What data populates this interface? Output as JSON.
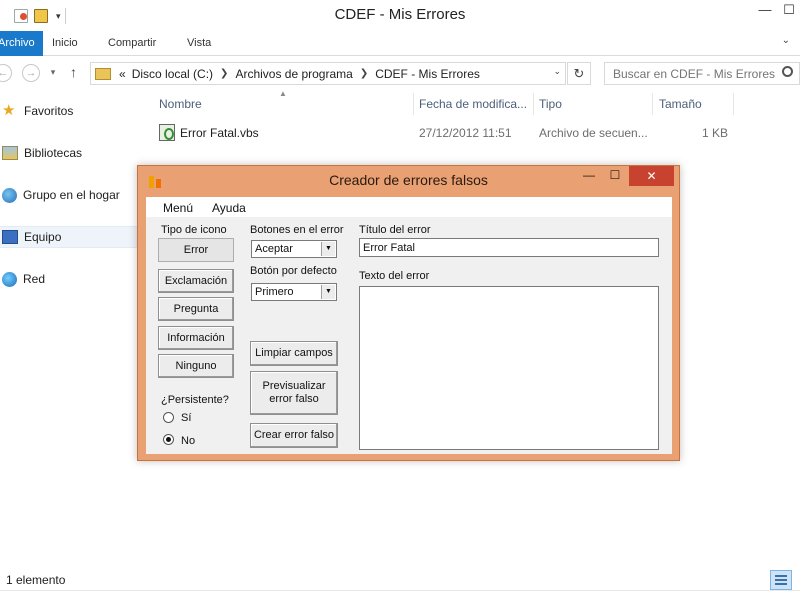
{
  "window": {
    "title": "CDEF - Mis Errores"
  },
  "ribbon": {
    "tabs": [
      "Archivo",
      "Inicio",
      "Compartir",
      "Vista"
    ]
  },
  "address": {
    "prefix": "«",
    "crumbs": [
      "Disco local (C:)",
      "Archivos de programa",
      "CDEF - Mis Errores"
    ],
    "search_placeholder": "Buscar en CDEF - Mis Errores"
  },
  "nav": {
    "items": [
      {
        "label": "Favoritos",
        "icon": "star-icon"
      },
      {
        "label": "Bibliotecas",
        "icon": "libraries-icon"
      },
      {
        "label": "Grupo en el hogar",
        "icon": "homegroup-icon"
      },
      {
        "label": "Equipo",
        "icon": "computer-icon",
        "selected": true
      },
      {
        "label": "Red",
        "icon": "network-icon"
      }
    ]
  },
  "filelist": {
    "columns": [
      "Nombre",
      "Fecha de modifica...",
      "Tipo",
      "Tamaño"
    ],
    "rows": [
      {
        "name": "Error Fatal.vbs",
        "date": "27/12/2012 11:51",
        "type": "Archivo de secuen...",
        "size": "1 KB"
      }
    ]
  },
  "status": {
    "text": "1 elemento"
  },
  "dialog": {
    "title": "Creador de errores falsos",
    "menu": [
      "Menú",
      "Ayuda"
    ],
    "icon_type": {
      "label": "Tipo de icono",
      "buttons": [
        "Error",
        "Exclamación",
        "Pregunta",
        "Información",
        "Ninguno"
      ]
    },
    "buttons_in_error": {
      "label": "Botones en el error",
      "value": "Aceptar"
    },
    "default_button": {
      "label": "Botón por defecto",
      "value": "Primero"
    },
    "persistent": {
      "label": "¿Persistente?",
      "yes": "Sí",
      "no": "No",
      "selected": "No"
    },
    "actions": {
      "clear": "Limpiar campos",
      "preview_line1": "Previsualizar",
      "preview_line2": "error falso",
      "create": "Crear error falso"
    },
    "error_title": {
      "label": "Título del error",
      "value": "Error Fatal"
    },
    "error_text": {
      "label": "Texto del error",
      "value": ""
    }
  },
  "colors": {
    "ribbon_file_tab": "#1979ca",
    "dialog_frame": "#e9a072",
    "dialog_close": "#c7432f"
  }
}
